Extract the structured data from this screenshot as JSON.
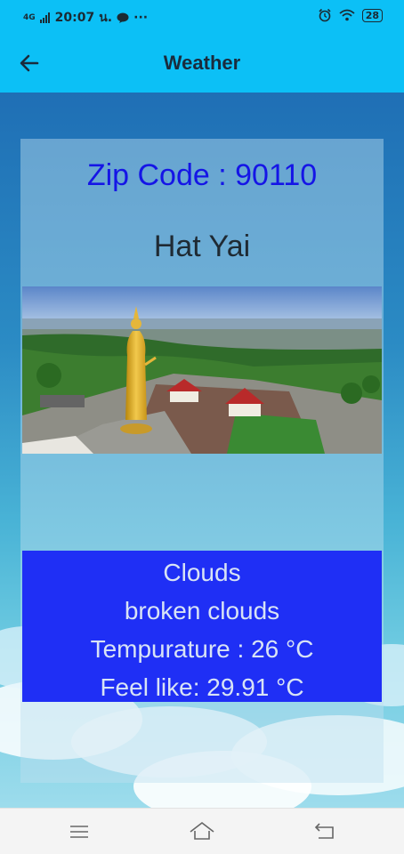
{
  "status_bar": {
    "network": "4G",
    "time": "20:07",
    "carrier_suffix": "น.",
    "more": "···",
    "battery": "28"
  },
  "app_bar": {
    "title": "Weather"
  },
  "card": {
    "zip_label": "Zip Code : 90110",
    "city": "Hat Yai",
    "weather_main": "Clouds",
    "weather_description": "broken clouds",
    "temperature": "Tempurature : 26 °C",
    "feels_like": "Feel like: 29.91 °C"
  },
  "colors": {
    "app_bar": "#0cc0f6",
    "zip_text": "#1515e6",
    "info_box": "#1f2ff5"
  },
  "icons": {
    "back": "arrow-left-icon",
    "menu": "menu-icon",
    "home": "home-icon",
    "return": "back-return-icon"
  }
}
